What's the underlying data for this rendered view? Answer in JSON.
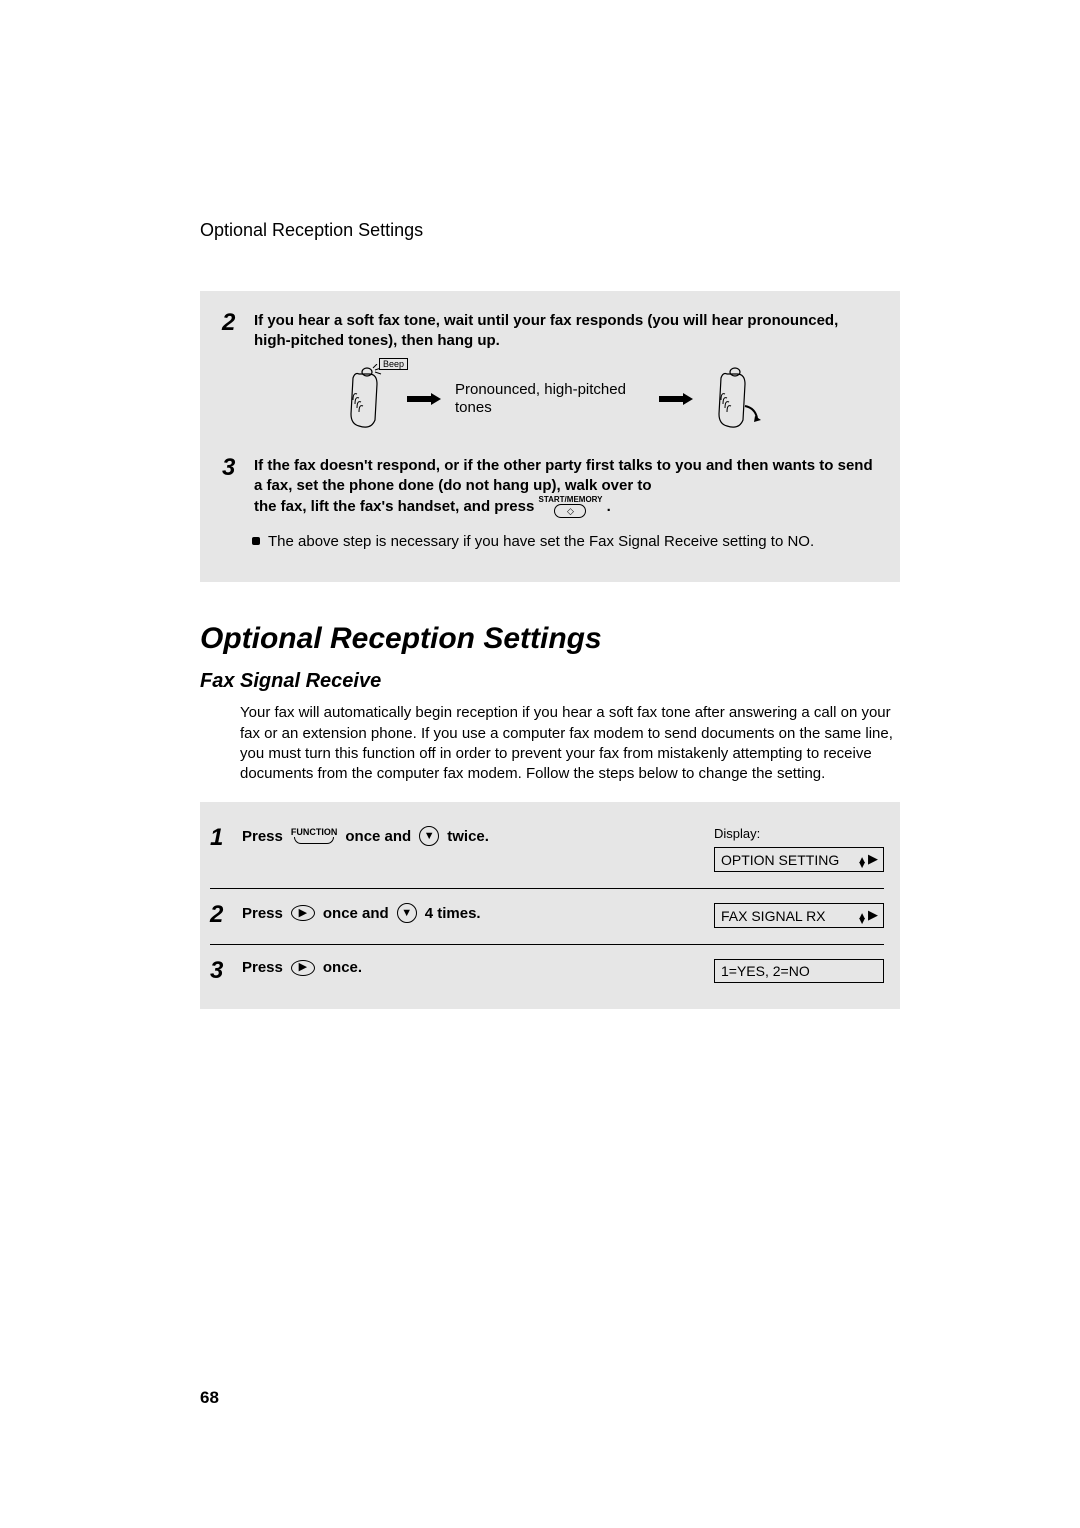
{
  "running_head": "Optional Reception Settings",
  "page_number": "68",
  "box1": {
    "step2": {
      "num": "2",
      "text": "If you hear a soft fax tone, wait until your fax responds (you will hear pronounced, high-pitched tones), then hang up."
    },
    "diagram": {
      "beep_label": "Beep",
      "tone_text": "Pronounced, high-pitched tones"
    },
    "step3": {
      "num": "3",
      "text_a": "If the fax doesn't respond, or if the other party first talks to you and then wants to send a fax, set the phone done (do not hang up), walk over to",
      "text_b": "the fax, lift the fax's handset, and press",
      "start_memory_label": "START/MEMORY",
      "period": "."
    },
    "bullet": "The above step is necessary if you have set the Fax Signal Receive setting to NO."
  },
  "section_title": "Optional Reception Settings",
  "sub_title": "Fax Signal Receive",
  "body_para": "Your fax will automatically begin reception if you hear a soft fax tone after answering a call on your fax or an extension phone. If you use a computer fax modem to send documents on the same line, you must turn this function off in order to prevent your fax from mistakenly attempting to receive documents from the computer fax modem. Follow the steps below to change the setting.",
  "proc": {
    "display_label": "Display:",
    "row1": {
      "num": "1",
      "press": "Press",
      "function_label": "FUNCTION",
      "once_and": "once and",
      "twice": "twice.",
      "lcd": "OPTION SETTING"
    },
    "row2": {
      "num": "2",
      "press": "Press",
      "once_and": "once and",
      "four_times": "4 times.",
      "lcd": "FAX SIGNAL RX"
    },
    "row3": {
      "num": "3",
      "press": "Press",
      "once": "once.",
      "lcd": "1=YES, 2=NO"
    }
  }
}
